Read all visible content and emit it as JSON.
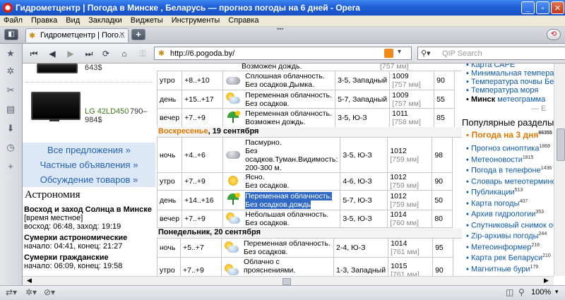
{
  "window": {
    "title": "Гидрометцентр | Погода в Минске , Беларусь — прогноз погоды на 6 дней - Opera"
  },
  "menu": [
    "Файл",
    "Правка",
    "Вид",
    "Закладки",
    "Виджеты",
    "Инструменты",
    "Справка"
  ],
  "tab": {
    "label": "Гидрометцентр | Пого..."
  },
  "address": {
    "url": "http://6.pogoda.by/"
  },
  "search": {
    "placeholder": "QIP Search"
  },
  "ads": {
    "price1": "643$",
    "tv_model": "LG 42LD450",
    "tv_price1": "790–",
    "tv_price2": "984$",
    "buttons": [
      "Все предложения »",
      "Частные объявления »",
      "Обсуждение товаров »"
    ]
  },
  "astronomy": {
    "title": "Астрономия",
    "sun_title": "Восход и заход Солнца в Минске",
    "local_time": "[время местное]",
    "sun_times": "восход: 06:48, заход: 19:19",
    "twilight_astro_title": "Сумерки астрономические",
    "twilight_astro_times": "начало: 04:41, конец: 21:27",
    "twilight_civil_title": "Сумерки гражданские",
    "twilight_civil_times": "начало: 06:09, конец: 19:58"
  },
  "forecast": {
    "top_partial": "Возможен дождь.",
    "top_partial_pressure": "[757 мм]",
    "block1": [
      {
        "period": "утро",
        "temp": "+8..+10",
        "icon": "cloud-icon",
        "desc1": "Сплошная облачность.",
        "desc2": "Без осадков.Дымка.",
        "wind": "3-5, Западный",
        "p1": "1009",
        "p2": "[757 мм]",
        "hum": "90"
      },
      {
        "period": "день",
        "temp": "+15..+17",
        "icon": "sun-cloud-icon",
        "desc1": "Переменная облачность.",
        "desc2": "Без осадков.",
        "wind": "5-7, Западный",
        "p1": "1009",
        "p2": "[757 мм]",
        "hum": "55"
      },
      {
        "period": "вечер",
        "temp": "+7..+9",
        "icon": "rain-icon",
        "desc1": "Переменная облачность.",
        "desc2": "Возможен дождь.",
        "wind": "3-5, Ю-З",
        "p1": "1011",
        "p2": "[758 мм]",
        "hum": "85"
      }
    ],
    "day2_header_name": "Воскресенье",
    "day2_header_date": ", 19 сентября",
    "block2": [
      {
        "period": "ночь",
        "temp": "+4..+6",
        "icon": "cloud-icon",
        "desc1": "Пасмурно.",
        "desc2": "Без осадков.Туман.Видимость: 200-300 м.",
        "wind": "3-5, Ю-З",
        "p1": "1012",
        "p2": "[759 мм]",
        "hum": "98"
      },
      {
        "period": "утро",
        "temp": "+7..+9",
        "icon": "sun-icon",
        "desc1": "Ясно.",
        "desc2": "Без осадков.",
        "wind": "4-6, Ю-З",
        "p1": "1012",
        "p2": "[759 мм]",
        "hum": "90"
      },
      {
        "period": "день",
        "temp": "+14..+16",
        "icon": "rain-icon",
        "desc1": "Переменная облачность.",
        "desc2": "Без осадков.дождь",
        "wind": "5-7, Ю-З",
        "p1": "1012",
        "p2": "[759 мм]",
        "hum": "50"
      },
      {
        "period": "вечер",
        "temp": "+7..+9",
        "icon": "sun-cloud-icon",
        "desc1": "Небольшая облачность.",
        "desc2": "Без осадков.",
        "wind": "3-5, Ю-З",
        "p1": "1014",
        "p2": "[760 мм]",
        "hum": "80"
      }
    ],
    "day3_header": "Понедельник, 20 сентября",
    "block3": [
      {
        "period": "ночь",
        "temp": "+5..+7",
        "icon": "sun-cloud-icon",
        "desc1": "Переменная облачность.",
        "desc2": "Без осадков.",
        "wind": "2-4, Ю-З",
        "p1": "1014",
        "p2": "[761 мм]",
        "hum": "95"
      },
      {
        "period": "утро",
        "temp": "+7..+9",
        "icon": "sun-cloud-icon",
        "desc1": "Облачно с прояснениями.",
        "desc2": "Без осадков.",
        "wind": "1-3, Западный",
        "p1": "1015",
        "p2": "[761 мм]",
        "hum": "90"
      }
    ]
  },
  "rightcol": {
    "top_links": [
      "Карта САРЕ",
      "Минимальная температура",
      "Температура почвы Беларуси",
      "Температура моря"
    ],
    "minsk_bold": "Минск",
    "minsk_link": "метеограмма",
    "popular_title": "Популярные разделы",
    "popular_first": "Погода на 3 дня",
    "popular_first_count": "66355",
    "popular": [
      {
        "label": "Прогноз синоптика",
        "count": "1868"
      },
      {
        "label": "Метеоновости",
        "count": "1815"
      },
      {
        "label": "Погода в телефоне",
        "count": "1436"
      },
      {
        "label": "Словарь метеотерминов",
        "count": ""
      },
      {
        "label": "Публикации",
        "count": "513"
      },
      {
        "label": "Карта погоды",
        "count": "407"
      },
      {
        "label": "Архив гидрологии",
        "count": "353"
      },
      {
        "label": "Спутниковый снимок облачности",
        "count": ""
      },
      {
        "label": "Zip-архивы погоды",
        "count": "244"
      },
      {
        "label": "Метеоинформер",
        "count": "216"
      },
      {
        "label": "Карта рек Беларуси",
        "count": "210"
      },
      {
        "label": "Магнитные бури",
        "count": "179"
      }
    ]
  },
  "statusbar": {
    "zoom": "100%"
  }
}
